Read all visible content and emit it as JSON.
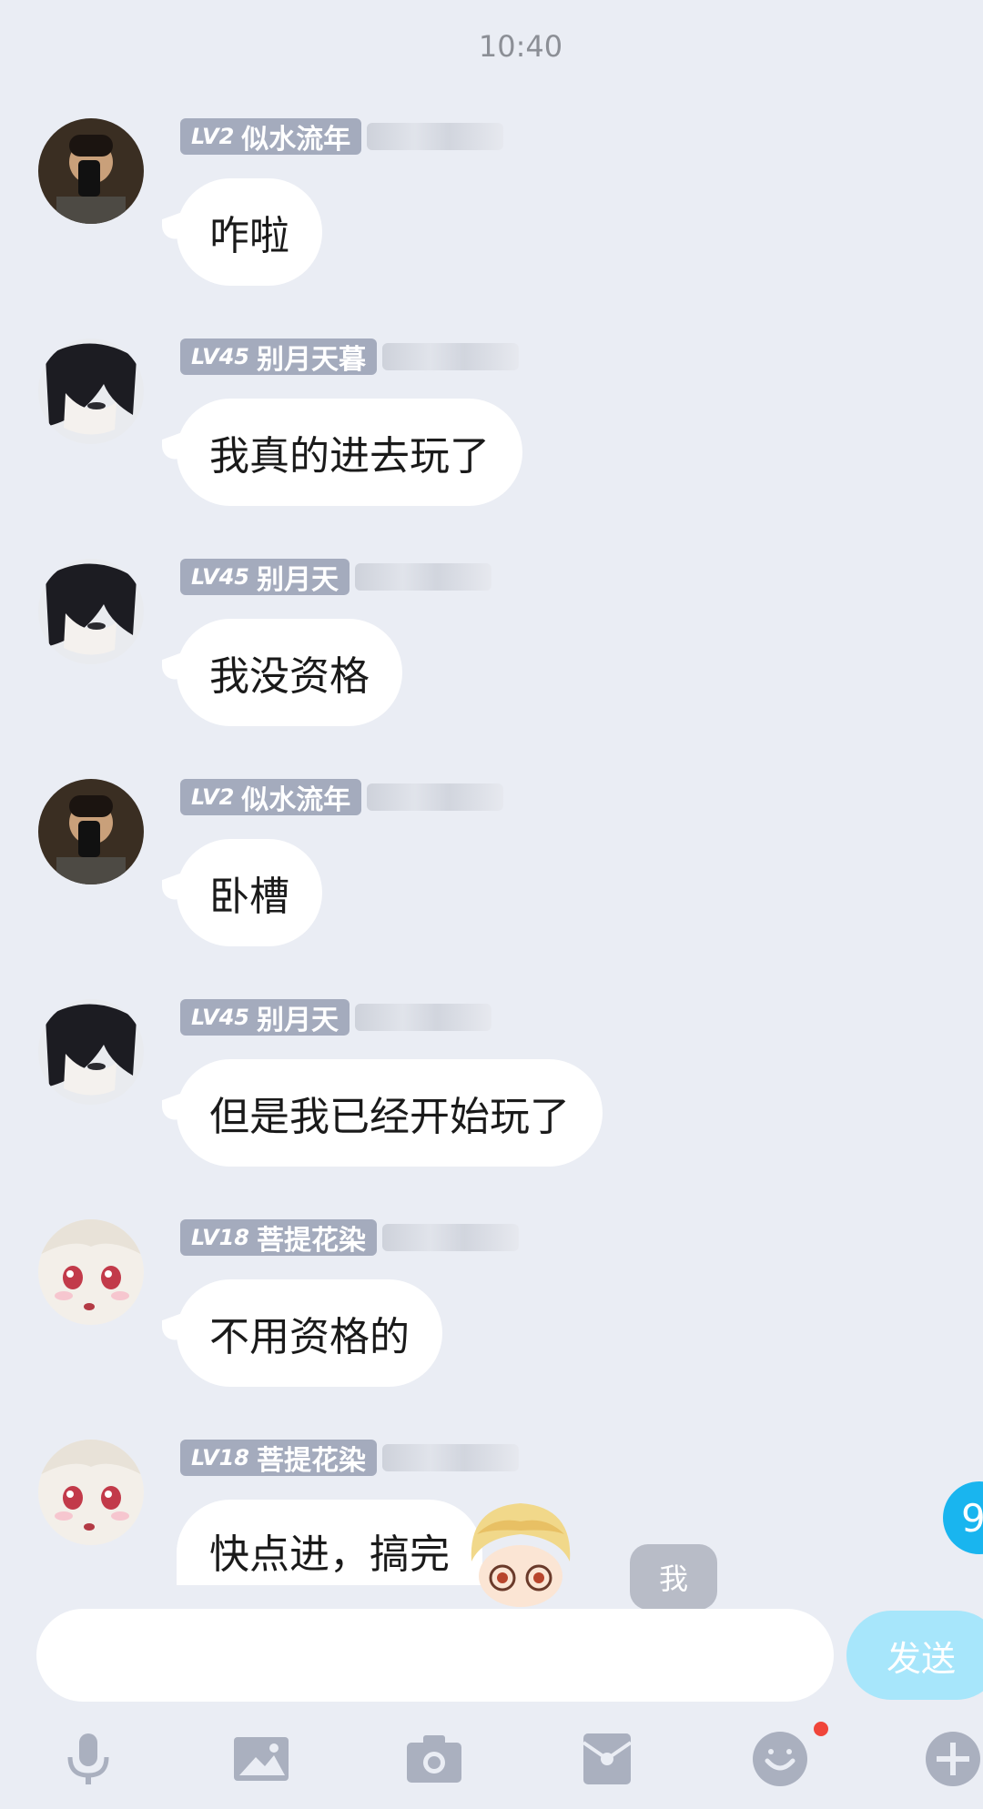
{
  "timestamp": "10:40",
  "colors": {
    "badge": "#a4abbd",
    "accent": "#19b5ef",
    "send_disabled": "#a7e6fb"
  },
  "messages": [
    {
      "level": "LV2",
      "name": "似水流年",
      "text": "咋啦",
      "avatar": "selfie-photo-avatar"
    },
    {
      "level": "LV45",
      "name": "别月天暮",
      "text": "我真的进去玩了",
      "avatar": "anime-dark-hair-avatar"
    },
    {
      "level": "LV45",
      "name": "别月天",
      "text": "我没资格",
      "avatar": "anime-dark-hair-avatar"
    },
    {
      "level": "LV2",
      "name": "似水流年",
      "text": "卧槽",
      "avatar": "selfie-photo-avatar"
    },
    {
      "level": "LV45",
      "name": "别月天",
      "text": "但是我已经开始玩了",
      "avatar": "anime-dark-hair-avatar"
    },
    {
      "level": "LV18",
      "name": "菩提花染",
      "text": "不用资格的",
      "avatar": "anime-white-hair-avatar"
    },
    {
      "level": "LV18",
      "name": "菩提花染",
      "text": "快点进，搞完",
      "avatar": "anime-white-hair-avatar"
    }
  ],
  "overlay": {
    "me_label": "我",
    "unread_count": "9"
  },
  "input": {
    "placeholder": "",
    "send_label": "发送"
  },
  "toolbar": [
    "microphone-icon",
    "image-icon",
    "camera-icon",
    "red-packet-icon",
    "emoji-icon",
    "plus-icon"
  ]
}
